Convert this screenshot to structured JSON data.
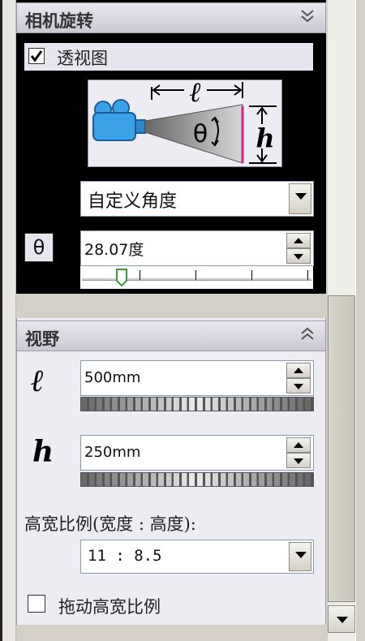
{
  "section_camera": {
    "title": "相机旋转",
    "collapse_icon": "double-chevron-down",
    "perspective_checkbox": {
      "label": "透视图",
      "checked": true
    },
    "diagram": {
      "length_symbol": "ℓ",
      "angle_symbol": "θ",
      "height_symbol": "h"
    },
    "angle_mode": {
      "selected": "自定义角度"
    },
    "theta_symbol": "θ",
    "angle": {
      "value": "28.07度",
      "slider_position_fraction": 0.16
    }
  },
  "section_field": {
    "title": "视野",
    "collapse_icon": "double-chevron-up",
    "length": {
      "symbol": "ℓ",
      "value": "500mm"
    },
    "height": {
      "symbol": "h",
      "value": "250mm"
    },
    "aspect_label": "高宽比例(宽度 : 高度):",
    "aspect": {
      "selected": "11 : 8.5"
    },
    "drag_aspect_checkbox": {
      "label": "拖动高宽比例",
      "checked": false
    }
  },
  "colors": {
    "dark_panel": "#000000",
    "header_gradient": "#dcdce6",
    "accent_magenta": "#d4248a",
    "camera_blue": "#3aa0e8"
  }
}
